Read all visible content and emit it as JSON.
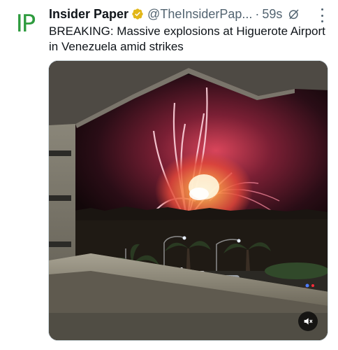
{
  "tweet": {
    "avatar_text": "IP",
    "author_name": "Insider Paper",
    "handle": "@TheInsiderPap...",
    "separator": "·",
    "timestamp": "59s",
    "body": "BREAKING: Massive explosions at Higuerote Airport in Venezuela amid strikes"
  },
  "icons": {
    "verified": "verified-badge-icon",
    "grok": "grok-icon",
    "more": "more-options-icon",
    "mute": "volume-muted-icon"
  },
  "colors": {
    "verified_gold": "#e2b719",
    "avatar_green": "#2e9b3e",
    "handle_gray": "#536471"
  }
}
